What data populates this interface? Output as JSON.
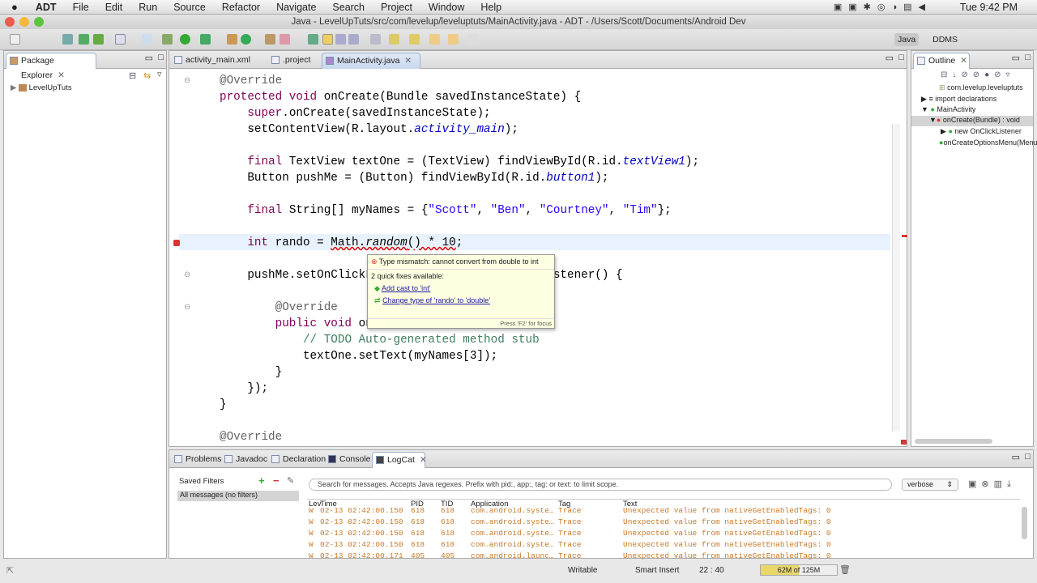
{
  "menubar": {
    "apple": "",
    "app": "ADT",
    "items": [
      "File",
      "Edit",
      "Run",
      "Source",
      "Refactor",
      "Navigate",
      "Search",
      "Project",
      "Window",
      "Help"
    ],
    "clock": "Tue 9:42 PM"
  },
  "window": {
    "title": "Java - LevelUpTuts/src/com/levelup/leveluptuts/MainActivity.java - ADT - /Users/Scott/Documents/Android Dev"
  },
  "perspectives": {
    "java": "Java",
    "ddms": "DDMS"
  },
  "package_explorer": {
    "title": "Package Explorer",
    "items": [
      {
        "label": "LevelUpTuts"
      }
    ]
  },
  "editor": {
    "tabs": [
      {
        "label": "activity_main.xml"
      },
      {
        "label": ".project"
      },
      {
        "label": "MainActivity.java",
        "active": true
      }
    ],
    "lines": [
      [
        [
          "@Override",
          "ann"
        ]
      ],
      [
        [
          "protected void ",
          "kw"
        ],
        [
          "onCreate(Bundle savedInstanceState) {",
          ""
        ]
      ],
      [
        [
          "    "
        ],
        [
          "super",
          "kw"
        ],
        [
          ".onCreate(savedInstanceState);",
          ""
        ]
      ],
      [
        [
          "    setContentView(R.layout.",
          ""
        ],
        [
          "activity_main",
          "fld"
        ],
        [
          ");",
          ""
        ]
      ],
      [],
      [
        [
          "    "
        ],
        [
          "final ",
          "kw"
        ],
        [
          "TextView textOne = (TextView) findViewById(R.id.",
          ""
        ],
        [
          "textView1",
          "fld"
        ],
        [
          ");",
          ""
        ]
      ],
      [
        [
          "    Button pushMe = (Button) findViewById(R.id.",
          ""
        ],
        [
          "button1",
          "fld"
        ],
        [
          ");",
          ""
        ]
      ],
      [],
      [
        [
          "    "
        ],
        [
          "final ",
          "kw"
        ],
        [
          "String[] myNames = {",
          ""
        ],
        [
          "\"Scott\"",
          "str"
        ],
        [
          ", ",
          ""
        ],
        [
          "\"Ben\"",
          "str"
        ],
        [
          ", ",
          ""
        ],
        [
          "\"Courtney\"",
          "str"
        ],
        [
          ", ",
          ""
        ],
        [
          "\"Tim\"",
          "str"
        ],
        [
          "};",
          ""
        ]
      ],
      [],
      [
        [
          "    "
        ],
        [
          "int ",
          "kw"
        ],
        [
          "rando = ",
          ""
        ],
        [
          "Math.",
          "err"
        ],
        [
          "random",
          "err ital"
        ],
        [
          "() * 10",
          "err"
        ],
        [
          ";",
          ""
        ]
      ],
      [],
      [
        [
          "    pushMe.setOnClickListener(",
          ""
        ],
        [
          "new ",
          "kw"
        ],
        [
          "View.OnClickListener() {",
          ""
        ]
      ],
      [],
      [
        [
          "        "
        ],
        [
          "@Override",
          "ann"
        ]
      ],
      [
        [
          "        "
        ],
        [
          "public void ",
          "kw"
        ],
        [
          "onClick(View v) {",
          ""
        ]
      ],
      [
        [
          "            "
        ],
        [
          "// TODO Auto-generated method stub",
          "com"
        ]
      ],
      [
        [
          "            textOne.setText(myNames[3]);",
          ""
        ]
      ],
      [
        [
          "        }",
          ""
        ]
      ],
      [
        [
          "    });",
          ""
        ]
      ],
      [
        [
          "}",
          ""
        ]
      ],
      [],
      [
        [
          "@Override",
          "ann"
        ]
      ]
    ],
    "quickfix": {
      "error": "Type mismatch: cannot convert from double to int",
      "count_label": "2 quick fixes available:",
      "fixes": [
        "Add cast to 'int'",
        "Change type of 'rando' to 'double'"
      ],
      "footer": "Press 'F2' for focus"
    }
  },
  "outline": {
    "title": "Outline",
    "items": [
      "com.levelup.leveluptuts",
      "import declarations",
      "MainActivity",
      "onCreate(Bundle) : void",
      "new OnClickListener",
      "onCreateOptionsMenu(Menu)"
    ]
  },
  "bottom": {
    "tabs": [
      "Problems",
      "Javadoc",
      "Declaration",
      "Console",
      "LogCat"
    ],
    "active": "LogCat",
    "saved_filters": "Saved Filters",
    "filter_all": "All messages (no filters)",
    "search_placeholder": "Search for messages. Accepts Java regexes. Prefix with pid:, app:, tag: or text: to limit scope.",
    "level": "verbose",
    "columns": [
      "Lev",
      "Time",
      "PID",
      "TID",
      "Application",
      "Tag",
      "Text"
    ],
    "rows": [
      [
        "W",
        "02-13 02:42:00.150",
        "618",
        "618",
        "com.android.syste…",
        "Trace",
        "Unexpected value from nativeGetEnabledTags: 0"
      ],
      [
        "W",
        "02-13 02:42:00.150",
        "618",
        "618",
        "com.android.syste…",
        "Trace",
        "Unexpected value from nativeGetEnabledTags: 0"
      ],
      [
        "W",
        "02-13 02:42:00.150",
        "618",
        "618",
        "com.android.syste…",
        "Trace",
        "Unexpected value from nativeGetEnabledTags: 0"
      ],
      [
        "W",
        "02-13 02:42:00.150",
        "618",
        "618",
        "com.android.syste…",
        "Trace",
        "Unexpected value from nativeGetEnabledTags: 0"
      ],
      [
        "W",
        "02-13 02:42:00.171",
        "405",
        "405",
        "com.android.launc…",
        "Trace",
        "Unexpected value from nativeGetEnabledTags: 0"
      ]
    ]
  },
  "status": {
    "mode": "Writable",
    "insert": "Smart Insert",
    "position": "22 : 40",
    "heap": "62M of 125M",
    "heap_fraction": 0.5
  }
}
